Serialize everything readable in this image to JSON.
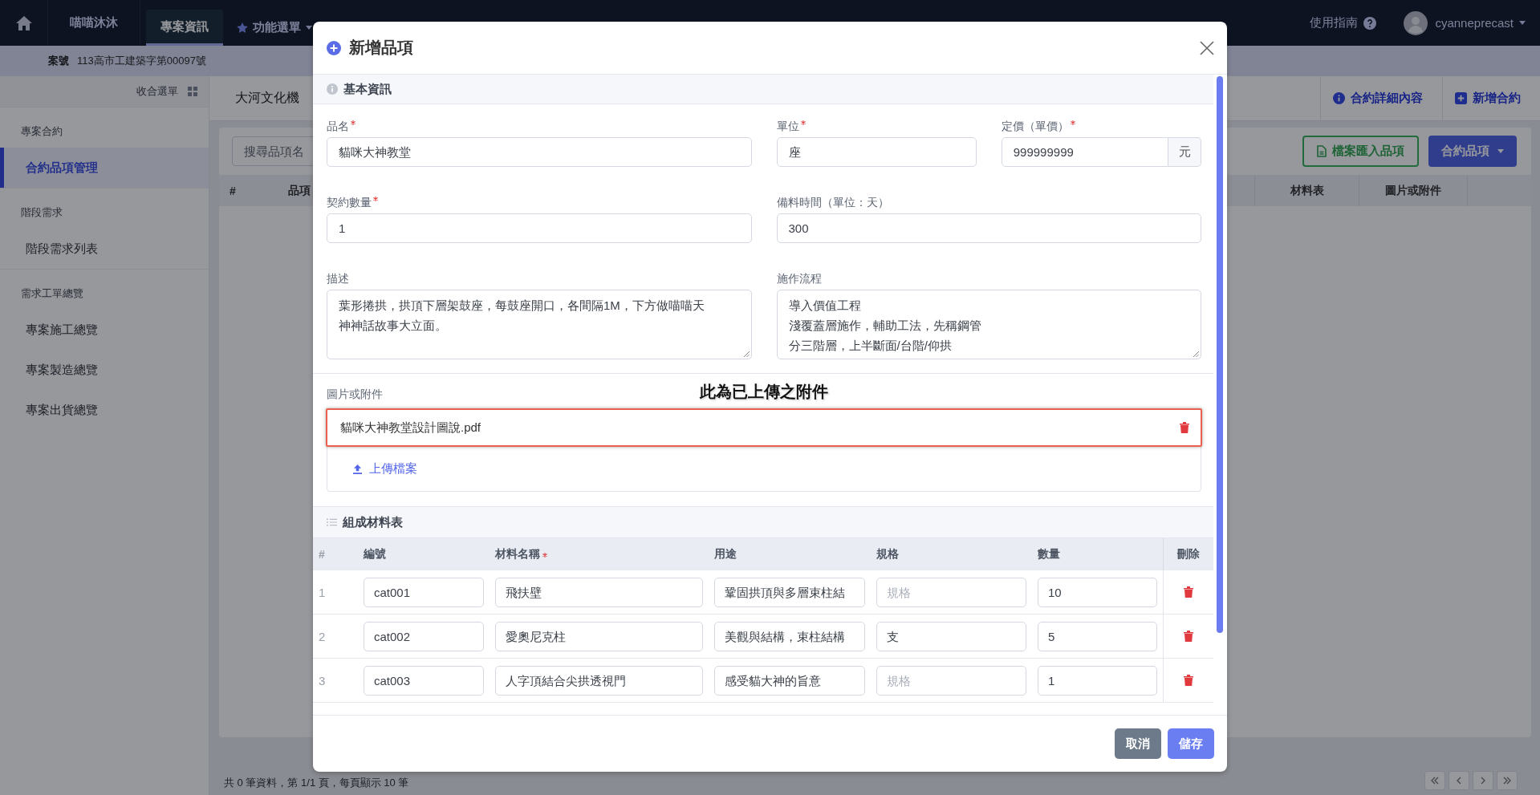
{
  "navbar": {
    "brand": "喵喵沐沐",
    "tabs": [
      {
        "label": "專案資訊",
        "kind": "tab",
        "selected": true
      },
      {
        "label": "功能選單",
        "kind": "menu",
        "selected": false
      }
    ],
    "help": "使用指南",
    "user": "cyanneprecast"
  },
  "case_bar": {
    "label": "案號",
    "value": "113高市工建築字第00097號"
  },
  "sidebar": {
    "collapse": "收合選單",
    "groups": [
      {
        "title": "專案合約",
        "items": [
          {
            "label": "合約品項管理",
            "selected": true
          }
        ]
      },
      {
        "title": "階段需求",
        "items": [
          {
            "label": "階段需求列表",
            "selected": false
          }
        ]
      },
      {
        "title": "需求工單總覽",
        "items": [
          {
            "label": "專案施工總覽",
            "selected": false
          },
          {
            "label": "專案製造總覽",
            "selected": false
          },
          {
            "label": "專案出貨總覽",
            "selected": false
          }
        ]
      }
    ]
  },
  "page": {
    "tab": "大河文化機",
    "actions": [
      {
        "label": "合約詳細內容",
        "kind": "info"
      },
      {
        "label": "新增合約",
        "kind": "add"
      }
    ],
    "search": {
      "placeholder": "搜尋品項名"
    },
    "buttons": [
      {
        "label": "檔案匯入品項",
        "kind": "import"
      },
      {
        "label": "合約品項",
        "kind": "dropdown"
      }
    ],
    "table": {
      "columns": [
        {
          "label": "#"
        },
        {
          "label": "品項"
        },
        {
          "label": "材料表"
        },
        {
          "label": "圖片或附件"
        }
      ]
    },
    "summary": "共 0 筆資料，第 1/1 頁，每頁顯示 10 筆"
  },
  "dialog": {
    "title": "新增品項",
    "basic": {
      "heading": "基本資訊",
      "rows": [
        [
          {
            "label": "品名",
            "required": true,
            "kind": "text",
            "value": "貓咪大神教堂"
          },
          {
            "label": "單位",
            "required": true,
            "kind": "text",
            "value": "座"
          },
          {
            "label": "定價（單價）",
            "required": true,
            "kind": "addon",
            "value": "999999999",
            "suffix": "元"
          }
        ],
        [
          {
            "label": "契約數量",
            "required": true,
            "kind": "text",
            "value": "1"
          },
          {
            "label": "備料時間（單位：天）",
            "required": false,
            "kind": "text",
            "value": "300"
          }
        ],
        [
          {
            "label": "描述",
            "required": false,
            "kind": "textarea",
            "lines": [
              "葉形捲拱，拱頂下層架鼓座，每鼓座開口，各間隔1M，下方做喵喵天神神話故事大立面。"
            ]
          },
          {
            "label": "施作流程",
            "required": false,
            "kind": "textarea",
            "lines": [
              "導入價值工程",
              "淺覆蓋層施作，輔助工法，先稱鋼管",
              "分三階層，上半斷面/台階/仰拱"
            ]
          }
        ]
      ]
    },
    "attachments": {
      "label": "圖片或附件",
      "callout": "此為已上傳之附件",
      "files": [
        {
          "name": "貓咪大神教堂設計圖說.pdf",
          "highlighted": true
        }
      ],
      "upload": "上傳檔案"
    },
    "materials": {
      "heading": "組成材料表",
      "columns": [
        {
          "label": "#",
          "required": false
        },
        {
          "label": "編號",
          "required": false
        },
        {
          "label": "材料名稱",
          "required": true
        },
        {
          "label": "用途",
          "required": false
        },
        {
          "label": "規格",
          "required": false
        },
        {
          "label": "數量",
          "required": false
        },
        {
          "label": "刪除",
          "required": false
        }
      ],
      "rows": [
        {
          "index": "1",
          "code": "cat001",
          "name": "飛扶壁",
          "use": "鞏固拱頂與多層束柱結",
          "spec_placeholder": "規格",
          "qty": "10"
        },
        {
          "index": "2",
          "code": "cat002",
          "name": "愛奧尼克柱",
          "use": "美觀與結構，束柱結構",
          "spec": "支",
          "qty": "5"
        },
        {
          "index": "3",
          "code": "cat003",
          "name": "人字頂結合尖拱透視門",
          "use": "感受貓大神的旨意",
          "spec_placeholder": "規格",
          "qty": "1"
        }
      ]
    },
    "buttons": [
      {
        "label": "取消",
        "kind": "secondary"
      },
      {
        "label": "儲存",
        "kind": "primary"
      }
    ]
  }
}
